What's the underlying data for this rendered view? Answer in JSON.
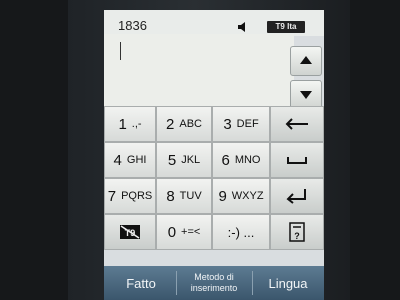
{
  "status": {
    "char_counter": "1836",
    "input_mode_badge": "T9 Ita"
  },
  "keypad": {
    "rows": [
      [
        {
          "num": "1",
          "letters": ".,-"
        },
        {
          "num": "2",
          "letters": "ABC"
        },
        {
          "num": "3",
          "letters": "DEF"
        }
      ],
      [
        {
          "num": "4",
          "letters": "GHI"
        },
        {
          "num": "5",
          "letters": "JKL"
        },
        {
          "num": "6",
          "letters": "MNO"
        }
      ],
      [
        {
          "num": "7",
          "letters": "PQRS"
        },
        {
          "num": "8",
          "letters": "TUV"
        },
        {
          "num": "9",
          "letters": "WXYZ"
        }
      ]
    ],
    "zero": {
      "num": "0",
      "symbols": "+=<"
    },
    "t9_toggle_label": "T9",
    "emoticon_label": ":-) ..."
  },
  "softkeys": {
    "left": "Fatto",
    "center": "Metodo di inserimento",
    "right": "Lingua"
  },
  "icons": {
    "scroll_up": "chevron-up-icon",
    "scroll_down": "chevron-down-icon",
    "backspace": "backspace-icon",
    "space": "space-icon",
    "enter": "enter-icon",
    "sound": "speaker-icon",
    "help": "help-icon"
  }
}
